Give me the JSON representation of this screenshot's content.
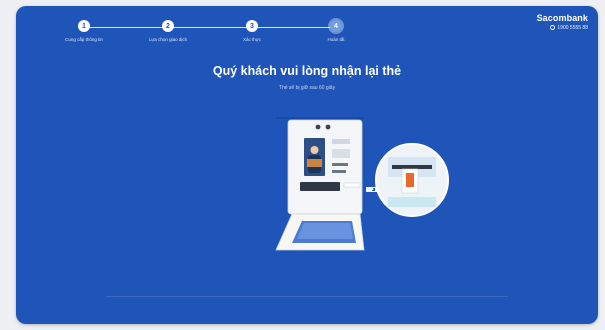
{
  "stepper": {
    "steps": [
      {
        "number": "1",
        "label": "Cung cấp thông tin"
      },
      {
        "number": "2",
        "label": "Lựa chọn giao dịch"
      },
      {
        "number": "3",
        "label": "Xác thực"
      },
      {
        "number": "4",
        "label": "Hoàn tất"
      }
    ],
    "current_step": 4
  },
  "brand": {
    "name": "Sacombank",
    "hotline": "1900 5555 88"
  },
  "main": {
    "title": "Quý khách vui lòng nhận lại thẻ",
    "subtitle": "Thẻ sẽ bị giữ sau 60 giây"
  },
  "colors": {
    "screen_background": "#1f55b8",
    "accent": "#6f9de3",
    "card_slot_highlight": "#e8692a"
  },
  "icons": {
    "illustration": "atm-card-return-illustration"
  }
}
